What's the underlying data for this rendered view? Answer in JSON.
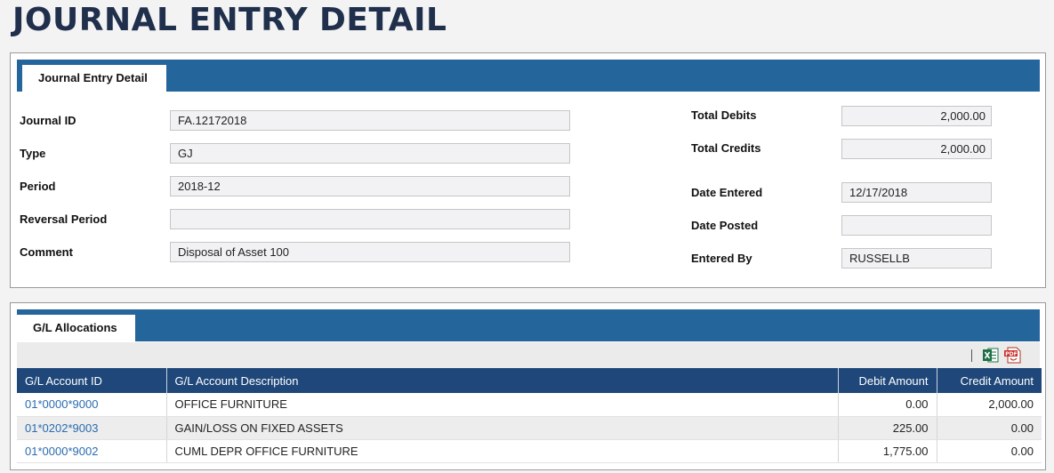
{
  "page": {
    "title": "JOURNAL ENTRY DETAIL"
  },
  "detail_panel": {
    "tab_label": "Journal Entry Detail",
    "left_fields": [
      {
        "label": "Journal ID",
        "value": "FA.12172018"
      },
      {
        "label": "Type",
        "value": "GJ"
      },
      {
        "label": "Period",
        "value": "2018-12"
      },
      {
        "label": "Reversal Period",
        "value": ""
      },
      {
        "label": "Comment",
        "value": "Disposal of Asset 100"
      }
    ],
    "right_fields": [
      {
        "label": "Total Debits",
        "value": "2,000.00"
      },
      {
        "label": "Total Credits",
        "value": "2,000.00"
      },
      {
        "label": "Date Entered",
        "value": "12/17/2018"
      },
      {
        "label": "Date Posted",
        "value": ""
      },
      {
        "label": "Entered By",
        "value": "RUSSELLB"
      }
    ]
  },
  "allocations_panel": {
    "tab_label": "G/L Allocations",
    "toolbar": {
      "excel_icon": "excel-export-icon",
      "pdf_icon": "pdf-export-icon"
    },
    "columns": [
      "G/L Account ID",
      "G/L Account Description",
      "Debit Amount",
      "Credit Amount"
    ],
    "rows": [
      {
        "account_id": "01*0000*9000",
        "description": "OFFICE FURNITURE",
        "debit": "0.00",
        "credit": "2,000.00"
      },
      {
        "account_id": "01*0202*9003",
        "description": "GAIN/LOSS ON FIXED ASSETS",
        "debit": "225.00",
        "credit": "0.00"
      },
      {
        "account_id": "01*0000*9002",
        "description": "CUML DEPR OFFICE FURNITURE",
        "debit": "1,775.00",
        "credit": "0.00"
      }
    ]
  },
  "colors": {
    "tab_bar": "#24659c",
    "table_header": "#1f477a",
    "title": "#1f2f4c",
    "link": "#2a6cb0"
  }
}
